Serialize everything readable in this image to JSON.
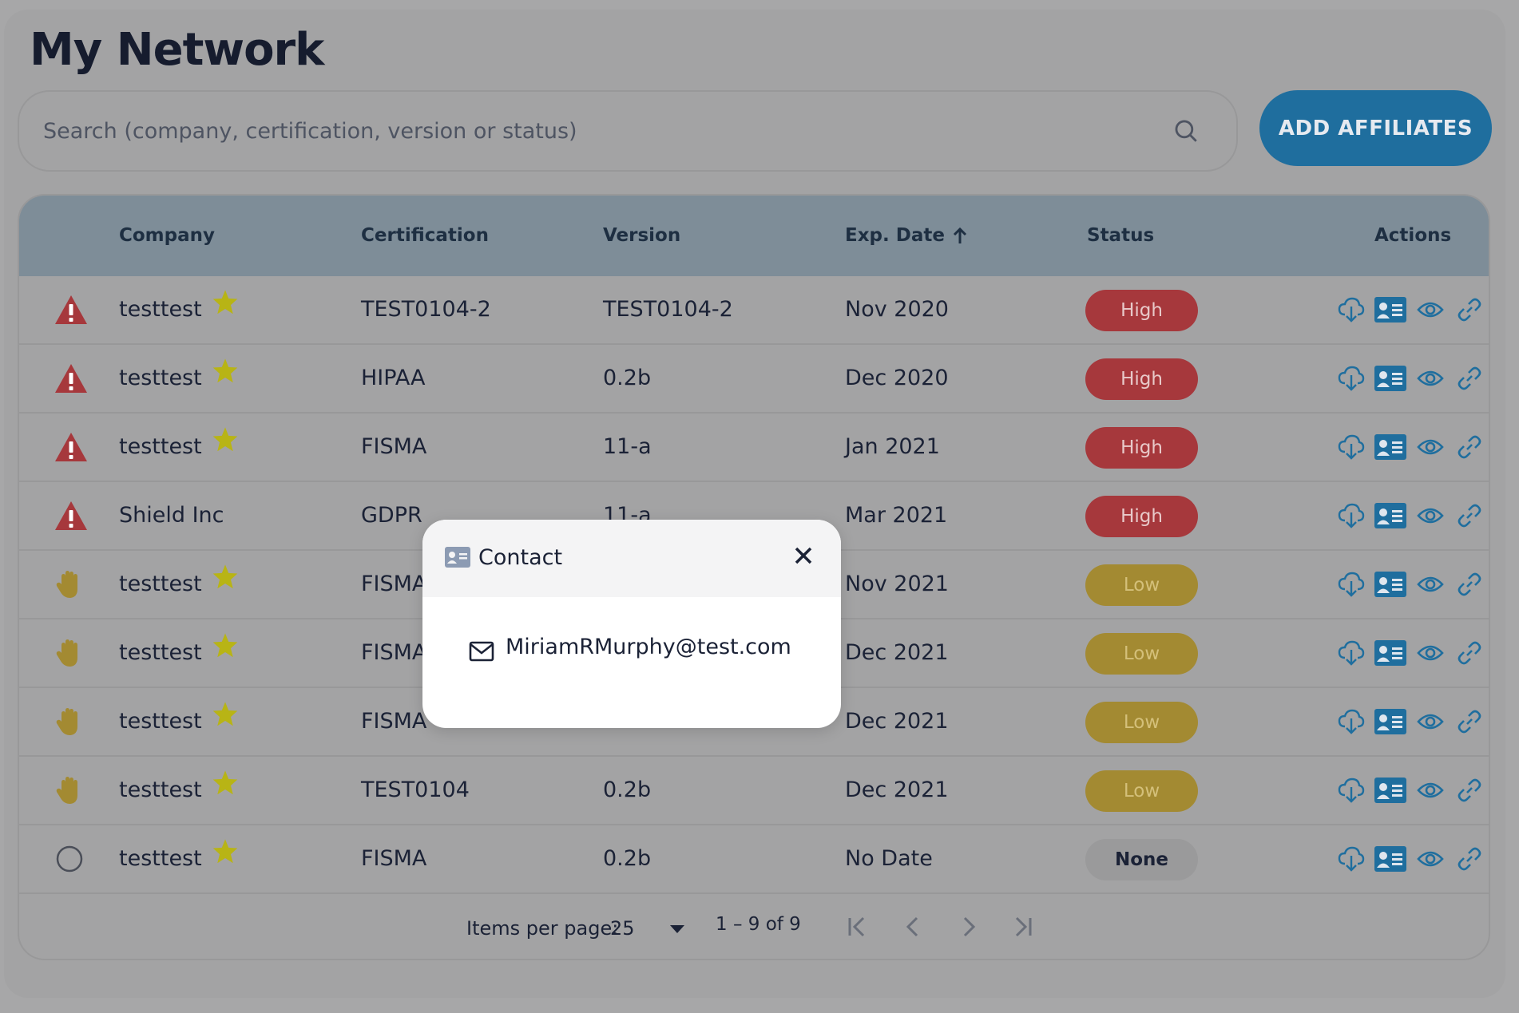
{
  "page": {
    "title": "My Network"
  },
  "search": {
    "placeholder": "Search (company, certification, version or status)"
  },
  "toolbar": {
    "add_label": "ADD AFFILIATES"
  },
  "table": {
    "headers": {
      "company": "Company",
      "certification": "Certification",
      "version": "Version",
      "exp_date": "Exp. Date",
      "status": "Status",
      "actions": "Actions"
    },
    "sort": {
      "column": "exp_date",
      "direction": "ascending"
    },
    "rows": [
      {
        "risk_icon": "warning-triangle-icon",
        "company": "testtest",
        "starred": true,
        "certification": "TEST0104-2",
        "version": "TEST0104-2",
        "exp_date": "Nov 2020",
        "status": "High"
      },
      {
        "risk_icon": "warning-triangle-icon",
        "company": "testtest",
        "starred": true,
        "certification": "HIPAA",
        "version": "0.2b",
        "exp_date": "Dec 2020",
        "status": "High"
      },
      {
        "risk_icon": "warning-triangle-icon",
        "company": "testtest",
        "starred": true,
        "certification": "FISMA",
        "version": "11-a",
        "exp_date": "Jan 2021",
        "status": "High"
      },
      {
        "risk_icon": "warning-triangle-icon",
        "company": "Shield Inc",
        "starred": false,
        "certification": "GDPR",
        "version": "11-a",
        "exp_date": "Mar 2021",
        "status": "High"
      },
      {
        "risk_icon": "hand-icon",
        "company": "testtest",
        "starred": true,
        "certification": "FISMA",
        "version": "",
        "exp_date": "Nov 2021",
        "status": "Low"
      },
      {
        "risk_icon": "hand-icon",
        "company": "testtest",
        "starred": true,
        "certification": "FISMA",
        "version": "",
        "exp_date": "Dec 2021",
        "status": "Low"
      },
      {
        "risk_icon": "hand-icon",
        "company": "testtest",
        "starred": true,
        "certification": "FISMA",
        "version": "",
        "exp_date": "Dec 2021",
        "status": "Low"
      },
      {
        "risk_icon": "hand-icon",
        "company": "testtest",
        "starred": true,
        "certification": "TEST0104",
        "version": "0.2b",
        "exp_date": "Dec 2021",
        "status": "Low"
      },
      {
        "risk_icon": "circle-icon",
        "company": "testtest",
        "starred": true,
        "certification": "FISMA",
        "version": "0.2b",
        "exp_date": "No Date",
        "status": "None"
      }
    ],
    "row_actions": [
      "cloud-download-icon",
      "contact-card-icon",
      "eye-icon",
      "link-icon"
    ]
  },
  "paginator": {
    "items_per_page_label": "Items per page:",
    "page_size": "25",
    "range_label": "1 – 9 of 9"
  },
  "modal": {
    "title": "Contact",
    "email": "MiriamRMurphy@test.com"
  },
  "colors": {
    "accent": "#1f6e9e",
    "high": "#a6383c",
    "low": "#a38a32",
    "star": "#b8b415"
  }
}
